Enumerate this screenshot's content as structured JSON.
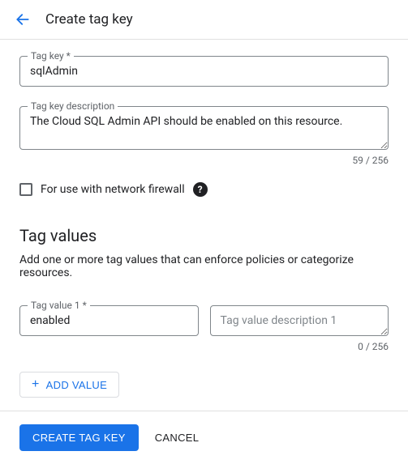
{
  "header": {
    "title": "Create tag key"
  },
  "form": {
    "tag_key": {
      "label": "Tag key *",
      "value": "sqlAdmin"
    },
    "tag_key_description": {
      "label": "Tag key description",
      "value": "The Cloud SQL Admin API should be enabled on this resource.",
      "char_count": "59 / 256"
    },
    "firewall_checkbox": {
      "label": "For use with network firewall",
      "checked": false
    }
  },
  "tag_values": {
    "section_title": "Tag values",
    "section_desc": "Add one or more tag values that can enforce policies or categorize resources.",
    "rows": [
      {
        "value_label": "Tag value 1 *",
        "value": "enabled",
        "desc_placeholder": "Tag value description 1",
        "char_count": "0 / 256"
      }
    ],
    "add_button_label": "ADD VALUE"
  },
  "footer": {
    "primary_label": "CREATE TAG KEY",
    "cancel_label": "CANCEL"
  }
}
